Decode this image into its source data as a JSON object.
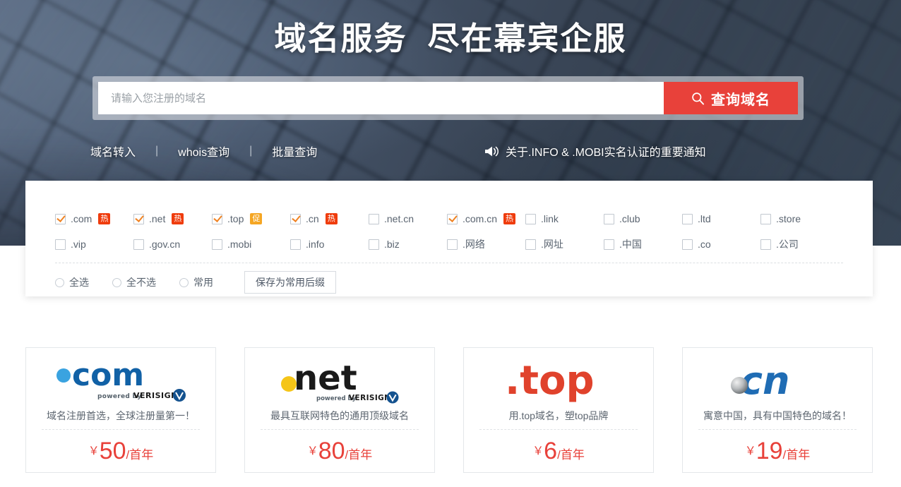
{
  "hero": {
    "title": "域名服务  尽在幕宾企服",
    "search": {
      "placeholder": "请输入您注册的域名",
      "value": "",
      "button_label": "查询域名",
      "button_icon": "search-icon",
      "button_color": "#e8413a"
    },
    "nav": {
      "links": [
        {
          "label": "域名转入"
        },
        {
          "label": "whois查询"
        },
        {
          "label": "批量查询"
        }
      ],
      "separator": "|",
      "announcement": {
        "icon": "megaphone-icon",
        "label": "关于.INFO & .MOBI实名认证的重要通知"
      }
    }
  },
  "tld_panel": {
    "rows": [
      [
        {
          "name": ".com",
          "checked": true,
          "badge": "热",
          "badge_type": "hot"
        },
        {
          "name": ".net",
          "checked": true,
          "badge": "热",
          "badge_type": "hot"
        },
        {
          "name": ".top",
          "checked": true,
          "badge": "促",
          "badge_type": "promo"
        },
        {
          "name": ".cn",
          "checked": true,
          "badge": "热",
          "badge_type": "hot"
        },
        {
          "name": ".net.cn",
          "checked": false,
          "badge": "",
          "badge_type": ""
        },
        {
          "name": ".com.cn",
          "checked": true,
          "badge": "热",
          "badge_type": "hot"
        },
        {
          "name": ".link",
          "checked": false,
          "badge": "",
          "badge_type": ""
        },
        {
          "name": ".club",
          "checked": false,
          "badge": "",
          "badge_type": ""
        },
        {
          "name": ".ltd",
          "checked": false,
          "badge": "",
          "badge_type": ""
        },
        {
          "name": ".store",
          "checked": false,
          "badge": "",
          "badge_type": ""
        }
      ],
      [
        {
          "name": ".vip",
          "checked": false,
          "badge": "",
          "badge_type": ""
        },
        {
          "name": ".gov.cn",
          "checked": false,
          "badge": "",
          "badge_type": ""
        },
        {
          "name": ".mobi",
          "checked": false,
          "badge": "",
          "badge_type": ""
        },
        {
          "name": ".info",
          "checked": false,
          "badge": "",
          "badge_type": ""
        },
        {
          "name": ".biz",
          "checked": false,
          "badge": "",
          "badge_type": ""
        },
        {
          "name": ".网络",
          "checked": false,
          "badge": "",
          "badge_type": ""
        },
        {
          "name": ".网址",
          "checked": false,
          "badge": "",
          "badge_type": ""
        },
        {
          "name": ".中国",
          "checked": false,
          "badge": "",
          "badge_type": ""
        },
        {
          "name": ".co",
          "checked": false,
          "badge": "",
          "badge_type": ""
        },
        {
          "name": ".公司",
          "checked": false,
          "badge": "",
          "badge_type": ""
        }
      ]
    ],
    "actions": {
      "radios": [
        {
          "label": "全选",
          "selected": false
        },
        {
          "label": "全不选",
          "selected": false
        },
        {
          "label": "常用",
          "selected": false
        }
      ],
      "save_label": "保存为常用后缀"
    },
    "checkbox_accent": "#f08323",
    "badge_hot_color": "#ef3c0d",
    "badge_promo_color": "#f5a623"
  },
  "cards": [
    {
      "logo": "com-verisign-logo",
      "logo_text": ".com",
      "logo_sub": "powered by VERISIGN",
      "desc": "域名注册首选，全球注册量第一！",
      "currency": "￥",
      "amount": "50",
      "period": "/首年"
    },
    {
      "logo": "net-verisign-logo",
      "logo_text": ".net",
      "logo_sub": "powered by VERISIGN",
      "desc": "最具互联网特色的通用顶级域名",
      "currency": "￥",
      "amount": "80",
      "period": "/首年"
    },
    {
      "logo": "top-logo",
      "logo_text": ".top",
      "logo_sub": "",
      "desc": "用.top域名，塑top品牌",
      "currency": "￥",
      "amount": "6",
      "period": "/首年"
    },
    {
      "logo": "cn-logo",
      "logo_text": "cn",
      "logo_sub": "",
      "desc": "寓意中国，具有中国特色的域名！",
      "currency": "￥",
      "amount": "19",
      "period": "/首年"
    }
  ]
}
